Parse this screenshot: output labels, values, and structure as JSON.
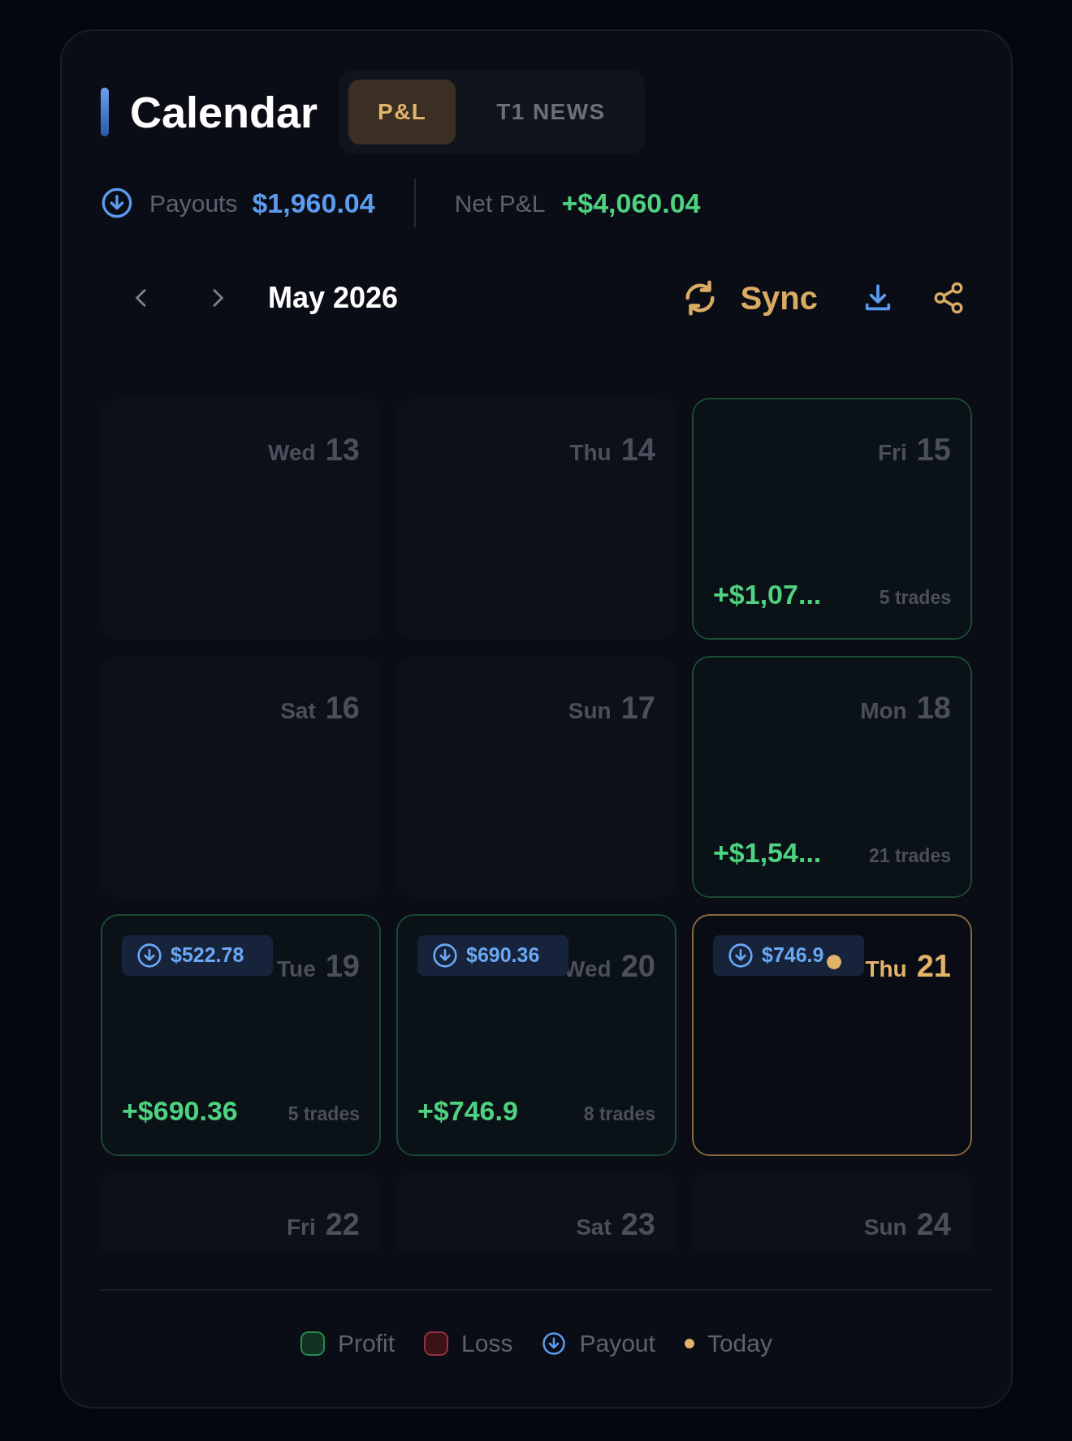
{
  "header": {
    "title": "Calendar",
    "tabs": [
      {
        "label": "P&L",
        "selected": true
      },
      {
        "label": "T1 NEWS",
        "selected": false
      }
    ]
  },
  "summary": {
    "payouts_label": "Payouts",
    "payouts_value": "$1,960.04",
    "net_label": "Net P&L",
    "net_value": "+$4,060.04"
  },
  "nav": {
    "month": "May 2026",
    "sync_label": "Sync"
  },
  "days": [
    {
      "kind": "empty",
      "weekday": "Wed",
      "day": "13"
    },
    {
      "kind": "empty",
      "weekday": "Thu",
      "day": "14"
    },
    {
      "kind": "profit",
      "weekday": "Fri",
      "day": "15",
      "pnl": "+$1,07...",
      "trades": "5 trades"
    },
    {
      "kind": "empty",
      "weekday": "Sat",
      "day": "16"
    },
    {
      "kind": "empty",
      "weekday": "Sun",
      "day": "17"
    },
    {
      "kind": "profit",
      "weekday": "Mon",
      "day": "18",
      "pnl": "+$1,54...",
      "trades": "21 trades"
    },
    {
      "kind": "profit",
      "weekday": "Tue",
      "day": "19",
      "pnl": "+$690.36",
      "trades": "5 trades",
      "payout": "$522.78"
    },
    {
      "kind": "profit",
      "weekday": "Wed",
      "day": "20",
      "pnl": "+$746.9",
      "trades": "8 trades",
      "payout": "$690.36"
    },
    {
      "kind": "today",
      "weekday": "Thu",
      "day": "21",
      "payout": "$746.9"
    },
    {
      "kind": "empty",
      "weekday": "Fri",
      "day": "22"
    },
    {
      "kind": "empty",
      "weekday": "Sat",
      "day": "23"
    },
    {
      "kind": "empty",
      "weekday": "Sun",
      "day": "24"
    }
  ],
  "legend": [
    {
      "kind": "profit",
      "label": "Profit"
    },
    {
      "kind": "loss",
      "label": "Loss"
    },
    {
      "kind": "payout",
      "label": "Payout"
    },
    {
      "kind": "today",
      "label": "Today"
    }
  ]
}
